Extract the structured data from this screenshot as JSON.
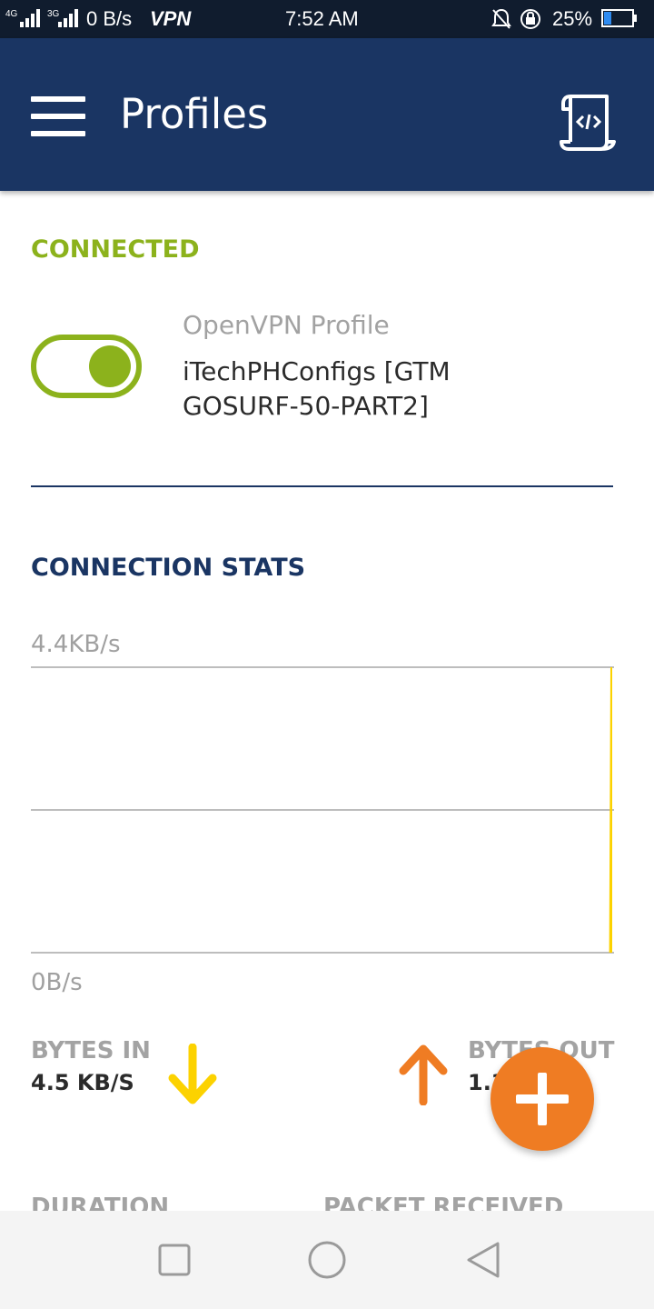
{
  "status_bar": {
    "network_label": "4G",
    "network_label_2": "3G",
    "speed": "0 B/s",
    "vpn": "VPN",
    "time": "7:52 AM",
    "battery_percent": "25%",
    "battery_level": 0.25
  },
  "app_bar": {
    "title": "Profiles"
  },
  "status": {
    "label": "CONNECTED",
    "color": "#8cb21c"
  },
  "profile": {
    "type": "OpenVPN Profile",
    "name": "iTechPHConfigs [GTM GOSURF-50-PART2]",
    "toggle_on": true
  },
  "stats": {
    "title": "CONNECTION STATS",
    "bytes_in_label": "BYTES IN",
    "bytes_in_value": "4.5 KB/S",
    "bytes_out_label": "BYTES OUT",
    "bytes_out_value": "1.3 KB/S",
    "duration_label": "DURATION",
    "packet_received_label": "PACKET RECEIVED"
  },
  "chart_data": {
    "type": "area",
    "y_max_label": "4.4KB/s",
    "y_min_label": "0B/s",
    "ylim": [
      0,
      4.4
    ],
    "series": [
      {
        "color": "#fcd200",
        "values": [
          0,
          0,
          0,
          0,
          0,
          0,
          0,
          0,
          0,
          0,
          4.4
        ]
      }
    ]
  },
  "colors": {
    "primary": "#1a3563",
    "accent": "#ef7c23",
    "download": "#fcd200",
    "upload": "#ef7c23"
  }
}
